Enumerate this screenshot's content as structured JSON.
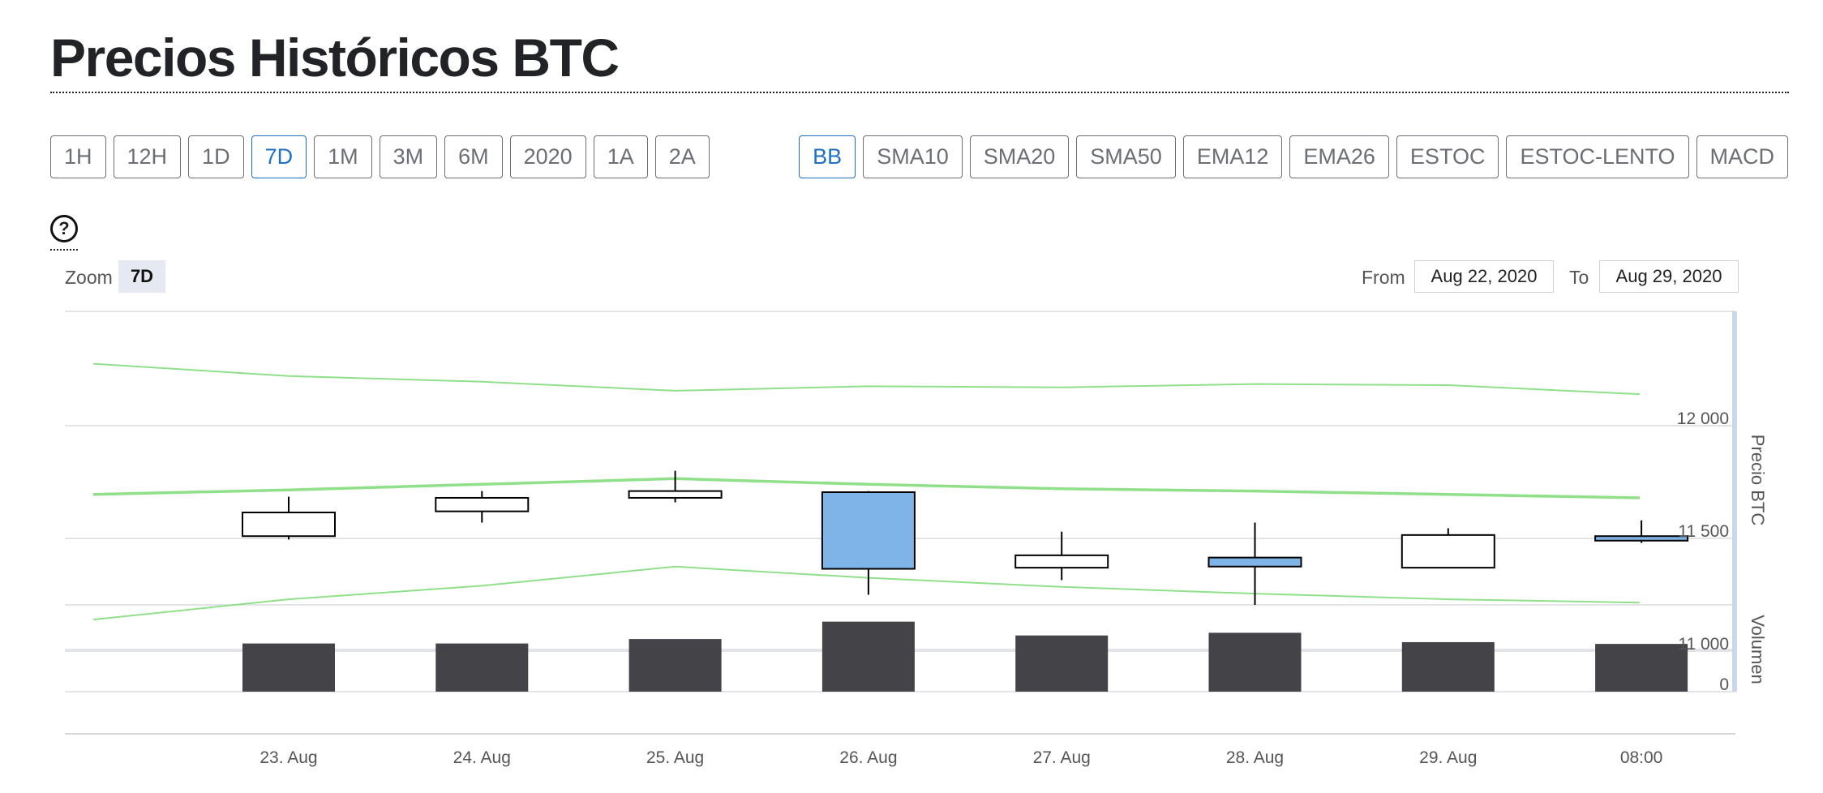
{
  "page": {
    "title": "Precios Históricos BTC"
  },
  "range_buttons": [
    {
      "label": "1H",
      "active": false
    },
    {
      "label": "12H",
      "active": false
    },
    {
      "label": "1D",
      "active": false
    },
    {
      "label": "7D",
      "active": true
    },
    {
      "label": "1M",
      "active": false
    },
    {
      "label": "3M",
      "active": false
    },
    {
      "label": "6M",
      "active": false
    },
    {
      "label": "2020",
      "active": false
    },
    {
      "label": "1A",
      "active": false
    },
    {
      "label": "2A",
      "active": false
    }
  ],
  "indicator_buttons": [
    {
      "label": "BB",
      "active": true
    },
    {
      "label": "SMA10",
      "active": false
    },
    {
      "label": "SMA20",
      "active": false
    },
    {
      "label": "SMA50",
      "active": false
    },
    {
      "label": "EMA12",
      "active": false
    },
    {
      "label": "EMA26",
      "active": false
    },
    {
      "label": "ESTOC",
      "active": false
    },
    {
      "label": "ESTOC-LENTO",
      "active": false
    },
    {
      "label": "MACD",
      "active": false
    }
  ],
  "help": {
    "symbol": "?"
  },
  "zoom": {
    "label": "Zoom",
    "value": "7D"
  },
  "date_range": {
    "from_label": "From",
    "from_value": "Aug 22, 2020",
    "to_label": "To",
    "to_value": "Aug 29, 2020"
  },
  "colors": {
    "up": "#ffffff",
    "down": "#7eb4e8",
    "band": "#90e08a",
    "volume": "#434348",
    "accent": "#1f6fc5"
  },
  "chart_data": {
    "type": "candlestick",
    "x_ticks": [
      "23. Aug",
      "24. Aug",
      "25. Aug",
      "26. Aug",
      "27. Aug",
      "28. Aug",
      "29. Aug",
      "08:00"
    ],
    "price_axis": {
      "label": "Precio BTC",
      "ticks": [
        "12 000",
        "11 500",
        "11 000"
      ],
      "tick_values": [
        12000,
        11500,
        11000
      ],
      "range": [
        10700,
        12500
      ]
    },
    "volume_axis": {
      "label": "Volumen",
      "ticks": [
        "0"
      ],
      "tick_values": [
        0
      ]
    },
    "candles": [
      {
        "x": "23. Aug",
        "open": 11510,
        "high": 11685,
        "low": 11495,
        "close": 11615
      },
      {
        "x": "24. Aug",
        "open": 11620,
        "high": 11710,
        "low": 11570,
        "close": 11680
      },
      {
        "x": "25. Aug",
        "open": 11680,
        "high": 11800,
        "low": 11660,
        "close": 11710
      },
      {
        "x": "26. Aug",
        "open": 11705,
        "high": 11710,
        "low": 11250,
        "close": 11365
      },
      {
        "x": "27. Aug",
        "open": 11370,
        "high": 11530,
        "low": 11315,
        "close": 11425
      },
      {
        "x": "28. Aug",
        "open": 11415,
        "high": 11570,
        "low": 11205,
        "close": 11375
      },
      {
        "x": "29. Aug",
        "open": 11370,
        "high": 11545,
        "low": 11370,
        "close": 11515
      },
      {
        "x": "08:00",
        "open": 11510,
        "high": 11580,
        "low": 11480,
        "close": 11490
      }
    ],
    "bollinger_bands": {
      "x": [
        "22. Aug",
        "23. Aug",
        "24. Aug",
        "25. Aug",
        "26. Aug",
        "27. Aug",
        "28. Aug",
        "29. Aug",
        "08:00"
      ],
      "upper": [
        12275,
        12220,
        12195,
        12155,
        12175,
        12170,
        12185,
        12180,
        12140
      ],
      "middle": [
        11695,
        11715,
        11740,
        11765,
        11740,
        11720,
        11710,
        11695,
        11680
      ],
      "lower": [
        11140,
        11230,
        11290,
        11375,
        11325,
        11285,
        11255,
        11230,
        11215
      ]
    },
    "volume": [
      1.08,
      1.08,
      1.18,
      1.57,
      1.26,
      1.32,
      1.11,
      1.07
    ]
  }
}
